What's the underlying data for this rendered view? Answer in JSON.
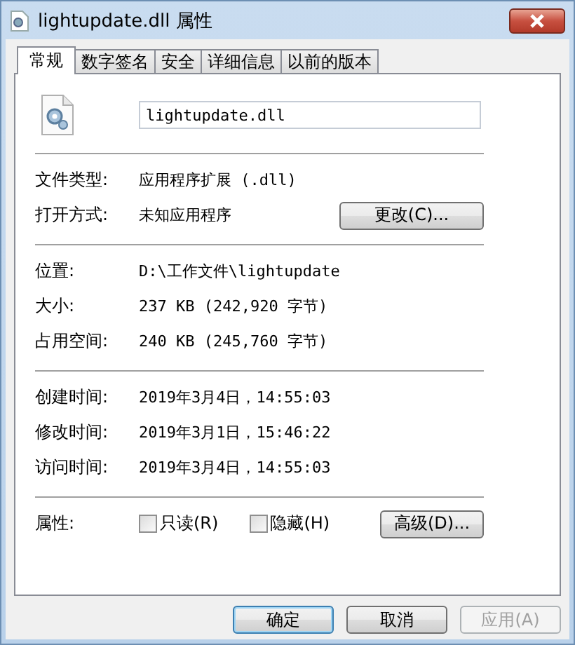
{
  "window": {
    "title": "lightupdate.dll 属性"
  },
  "tabs": [
    {
      "label": "常规",
      "selected": true
    },
    {
      "label": "数字签名",
      "selected": false
    },
    {
      "label": "安全",
      "selected": false
    },
    {
      "label": "详细信息",
      "selected": false
    },
    {
      "label": "以前的版本",
      "selected": false
    }
  ],
  "file_name": {
    "value": "lightupdate.dll"
  },
  "groups": [
    [
      {
        "label": "文件类型:",
        "value": "应用程序扩展 (.dll)"
      },
      {
        "label": "打开方式:",
        "value": "未知应用程序",
        "button": "更改(C)..."
      }
    ],
    [
      {
        "label": "位置:",
        "value": "D:\\工作文件\\lightupdate"
      },
      {
        "label": "大小:",
        "value": "237 KB (242,920 字节)"
      },
      {
        "label": "占用空间:",
        "value": "240 KB (245,760 字节)"
      }
    ],
    [
      {
        "label": "创建时间:",
        "value": "2019年3月4日，14:55:03"
      },
      {
        "label": "修改时间:",
        "value": "2019年3月1日，15:46:22"
      },
      {
        "label": "访问时间:",
        "value": "2019年3月4日，14:55:03"
      }
    ]
  ],
  "attributes": {
    "label": "属性:",
    "checkboxes": [
      {
        "label": "只读(R)",
        "checked": false
      },
      {
        "label": "隐藏(H)",
        "checked": false
      }
    ],
    "button": "高级(D)..."
  },
  "buttons": [
    {
      "label": "确定",
      "default": true,
      "disabled": false
    },
    {
      "label": "取消",
      "default": false,
      "disabled": false
    },
    {
      "label": "应用(A)",
      "default": false,
      "disabled": true
    }
  ]
}
